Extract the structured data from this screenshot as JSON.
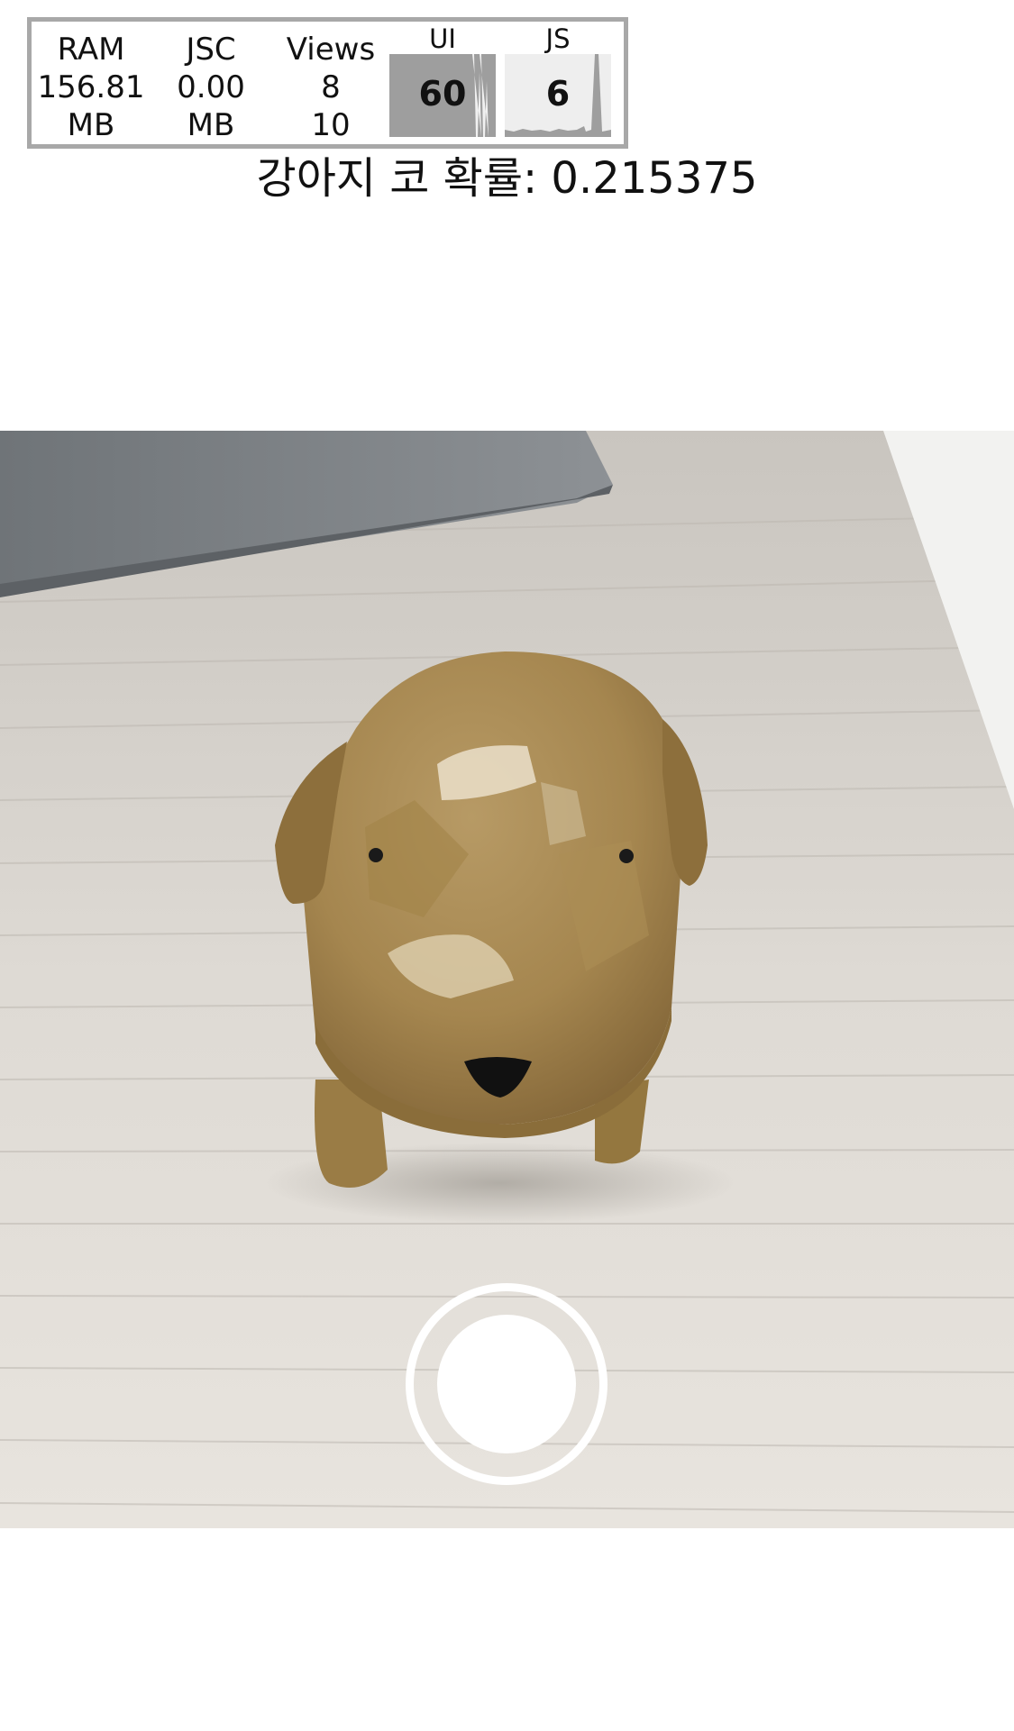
{
  "perf_monitor": {
    "ram": {
      "label": "RAM",
      "value": "156.81",
      "unit": "MB"
    },
    "jsc": {
      "label": "JSC",
      "value": "0.00",
      "unit": "MB"
    },
    "views": {
      "label": "Views",
      "visible": "8",
      "total": "10"
    },
    "ui_fps": {
      "label": "UI",
      "value": "60"
    },
    "js_fps": {
      "label": "JS",
      "value": "6"
    }
  },
  "detection": {
    "text": "강아지 코 확률: 0.215375"
  },
  "camera": {
    "subject_icon": "wooden-dog-figurine",
    "shutter_icon": "shutter-button-icon"
  }
}
